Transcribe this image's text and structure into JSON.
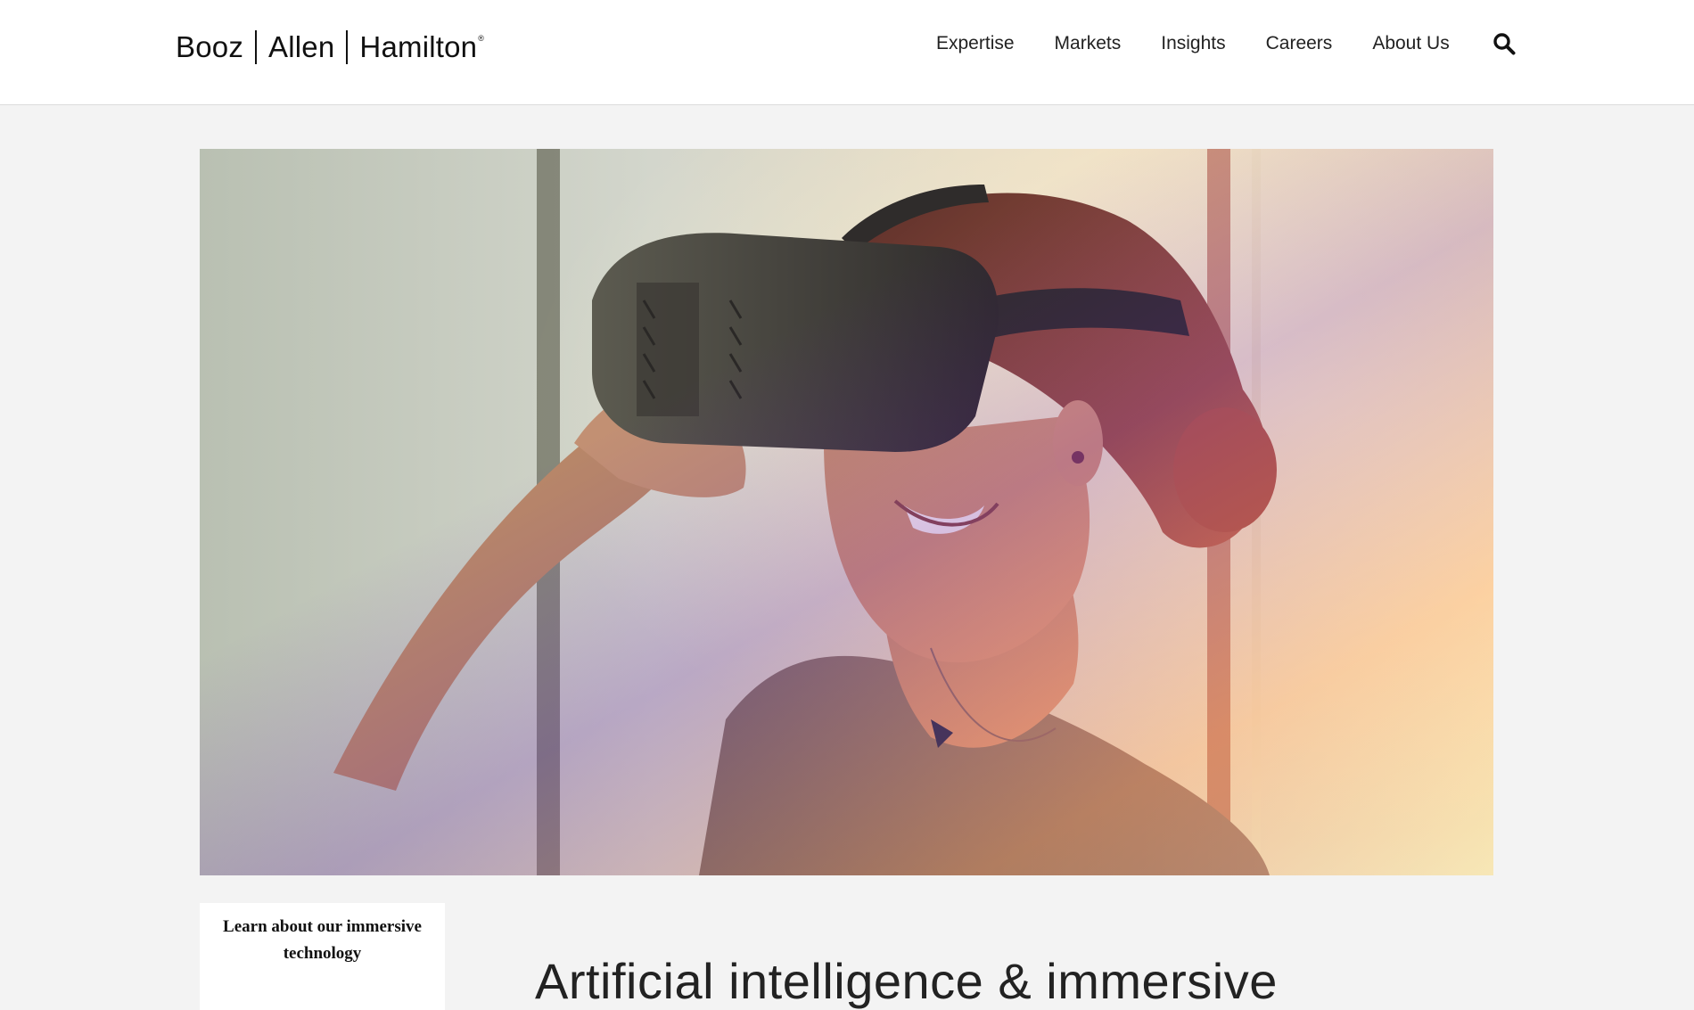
{
  "logo": {
    "parts": [
      "Booz",
      "Allen",
      "Hamilton"
    ],
    "mark": "®"
  },
  "nav": {
    "items": [
      "Expertise",
      "Markets",
      "Insights",
      "Careers",
      "About Us"
    ],
    "search_icon": "search-icon"
  },
  "hero": {
    "image_subject": "woman-wearing-vr-headset"
  },
  "side_card": {
    "label": "Learn about our immersive technology"
  },
  "main": {
    "headline": "Artificial intelligence & immersive"
  },
  "colors": {
    "background": "#f3f3f3",
    "header": "#ffffff",
    "text": "#222222"
  }
}
